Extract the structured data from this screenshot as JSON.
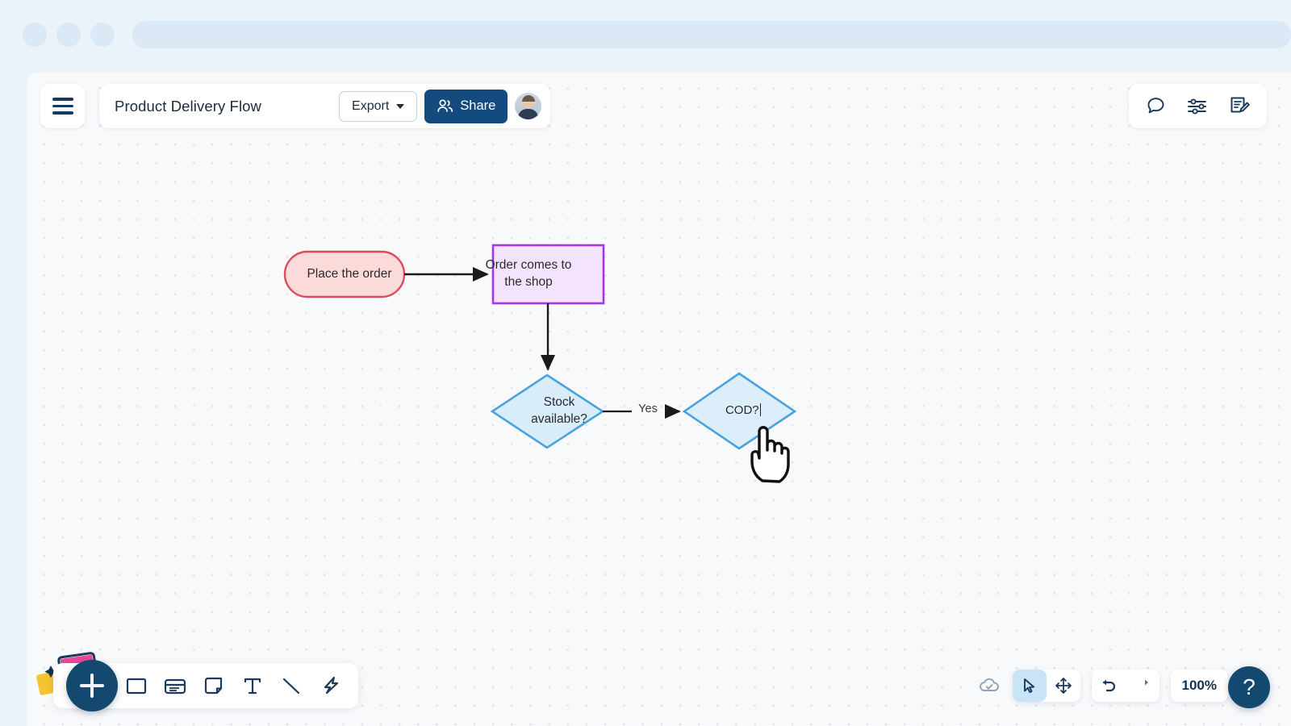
{
  "browser": {
    "dots": [
      "dot-1",
      "dot-2",
      "dot-3"
    ],
    "urlbar_value": ""
  },
  "header": {
    "menu_icon": "hamburger-menu-icon",
    "doc_title": "Product Delivery Flow",
    "export_label": "Export",
    "export_caret_icon": "chevron-down-icon",
    "share_label": "Share",
    "share_icon": "people-icon",
    "avatar_alt": "user-avatar",
    "share_bg": "#134b7e"
  },
  "topright_tools": [
    {
      "name": "comment-icon",
      "label": "Comments"
    },
    {
      "name": "sliders-icon",
      "label": "Settings"
    },
    {
      "name": "note-edit-icon",
      "label": "Notes"
    }
  ],
  "diagram": {
    "nodes": [
      {
        "id": "place-order",
        "label": "Place the order",
        "shape": "rounded-pill",
        "fill": "#fbdada",
        "stroke": "#d94b5e"
      },
      {
        "id": "order-shop",
        "label": "Order comes to\nthe shop",
        "shape": "rectangle",
        "fill": "#f3e3fc",
        "stroke": "#a736e8"
      },
      {
        "id": "stock",
        "label": "Stock\navailable?",
        "shape": "diamond",
        "fill": "#d9ecfa",
        "stroke": "#4aa3dd"
      },
      {
        "id": "cod",
        "label": "COD?",
        "shape": "diamond",
        "fill": "#ddeefb",
        "stroke": "#4aa3dd",
        "editing": true
      }
    ],
    "node_labels": {
      "place_order": "Place the order",
      "order_shop_line1": "Order comes to",
      "order_shop_line2": "the shop",
      "stock_line1": "Stock",
      "stock_line2": "available?",
      "cod": "COD?"
    },
    "edges": [
      {
        "from": "place-order",
        "to": "order-shop",
        "label": ""
      },
      {
        "from": "order-shop",
        "to": "stock",
        "label": ""
      },
      {
        "from": "stock",
        "to": "cod",
        "label": "Yes"
      }
    ],
    "edge_labels": {
      "yes": "Yes"
    }
  },
  "cursor": {
    "name": "pointing-hand-cursor"
  },
  "shape_toolbar": {
    "add_label": "+",
    "items": [
      {
        "name": "rectangle-shape-icon",
        "label": "Rectangle"
      },
      {
        "name": "card-shape-icon",
        "label": "Card"
      },
      {
        "name": "note-shape-icon",
        "label": "Note"
      },
      {
        "name": "text-tool-icon",
        "label": "Text"
      },
      {
        "name": "line-tool-icon",
        "label": "Line"
      },
      {
        "name": "pen-tool-icon",
        "label": "Pen"
      }
    ]
  },
  "status_bar": {
    "save_icon": "cloud-saved-icon",
    "select_icon": "cursor-arrow-icon",
    "pan_icon": "move-arrows-icon",
    "undo_icon": "undo-icon",
    "redo_icon": "redo-icon",
    "zoom_level": "100%",
    "keyboard_icon": "keyboard-icon",
    "help_label": "?",
    "active_tool": "cursor-arrow-icon"
  },
  "colors": {
    "brand_navy": "#13486f",
    "canvas_bg": "#f8f9fb",
    "chrome_bg": "#eaf2fa"
  }
}
